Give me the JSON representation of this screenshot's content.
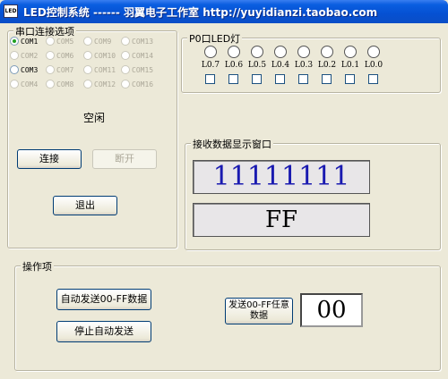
{
  "window": {
    "icon_text": "LED",
    "title": "LED控制系统 ------ 羽翼电子工作室 http://yuyidianzi.taobao.com"
  },
  "serial": {
    "legend": "串口连接选项",
    "ports": [
      {
        "label": "COM1",
        "checked": true,
        "enabled": true
      },
      {
        "label": "COM5",
        "checked": false,
        "enabled": false
      },
      {
        "label": "COM9",
        "checked": false,
        "enabled": false
      },
      {
        "label": "COM13",
        "checked": false,
        "enabled": false
      },
      {
        "label": "COM2",
        "checked": false,
        "enabled": false
      },
      {
        "label": "COM6",
        "checked": false,
        "enabled": false
      },
      {
        "label": "COM10",
        "checked": false,
        "enabled": false
      },
      {
        "label": "COM14",
        "checked": false,
        "enabled": false
      },
      {
        "label": "COM3",
        "checked": false,
        "enabled": true
      },
      {
        "label": "COM7",
        "checked": false,
        "enabled": false
      },
      {
        "label": "COM11",
        "checked": false,
        "enabled": false
      },
      {
        "label": "COM15",
        "checked": false,
        "enabled": false
      },
      {
        "label": "COM4",
        "checked": false,
        "enabled": false
      },
      {
        "label": "COM8",
        "checked": false,
        "enabled": false
      },
      {
        "label": "COM12",
        "checked": false,
        "enabled": false
      },
      {
        "label": "COM16",
        "checked": false,
        "enabled": false
      }
    ],
    "status": "空闲",
    "connect_label": "连接",
    "disconnect_label": "断开",
    "exit_label": "退出"
  },
  "leds": {
    "legend": "P0口LED灯",
    "labels": [
      "L0.7",
      "L0.6",
      "L0.5",
      "L0.4",
      "L0.3",
      "L0.2",
      "L0.1",
      "L0.0"
    ]
  },
  "receive": {
    "legend": "接收数据显示窗口",
    "binary": "11111111",
    "hex": "FF",
    "binary_color": "#1a1ab0"
  },
  "ops": {
    "legend": "操作项",
    "auto_send_label": "自动发送00-FF数据",
    "stop_label": "停止自动发送",
    "send_any_label": "发送00-FF任意数据",
    "value": "00"
  }
}
